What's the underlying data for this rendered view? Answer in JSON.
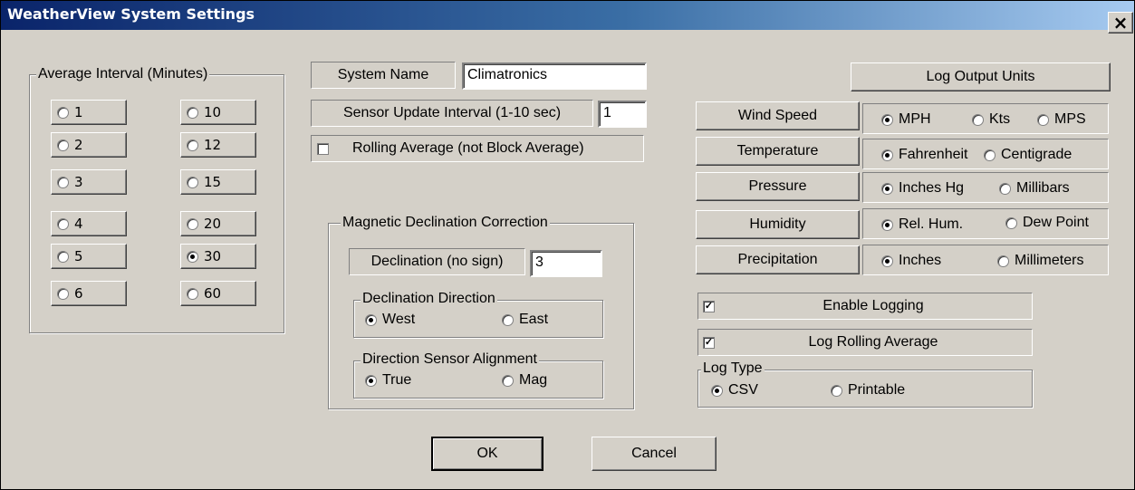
{
  "window": {
    "title": "WeatherView System Settings"
  },
  "avg_interval": {
    "legend": "Average Interval (Minutes)",
    "options": [
      "1",
      "2",
      "3",
      "4",
      "5",
      "6",
      "10",
      "12",
      "15",
      "20",
      "30",
      "60"
    ],
    "selected": "30"
  },
  "system": {
    "name_label": "System Name",
    "name_value": "Climatronics",
    "update_label": "Sensor Update Interval (1-10 sec)",
    "update_value": "1",
    "rolling_label": "Rolling Average (not Block Average)",
    "rolling_checked": false
  },
  "declination": {
    "legend": "Magnetic Declination Correction",
    "label": "Declination (no sign)",
    "value": "3",
    "direction_legend": "Declination Direction",
    "west": "West",
    "east": "East",
    "alignment_legend": "Direction Sensor Alignment",
    "true_label": "True",
    "mag_label": "Mag"
  },
  "units": {
    "header": "Log Output Units",
    "wind_label": "Wind Speed",
    "wind_opt1": "MPH",
    "wind_opt2": "Kts",
    "wind_opt3": "MPS",
    "temp_label": "Temperature",
    "temp_opt1": "Fahrenheit",
    "temp_opt2": "Centigrade",
    "press_label": "Pressure",
    "press_opt1": "Inches Hg",
    "press_opt2": "Millibars",
    "hum_label": "Humidity",
    "hum_opt1": "Rel. Hum.",
    "hum_opt2": "Dew Point",
    "precip_label": "Precipitation",
    "precip_opt1": "Inches",
    "precip_opt2": "Millimeters"
  },
  "logging": {
    "enable_label": "Enable Logging",
    "enable_checked": true,
    "rolling_label": "Log Rolling Average",
    "rolling_checked": true,
    "type_legend": "Log Type",
    "csv": "CSV",
    "printable": "Printable"
  },
  "buttons": {
    "ok": "OK",
    "cancel": "Cancel",
    "close_glyph": "×"
  }
}
